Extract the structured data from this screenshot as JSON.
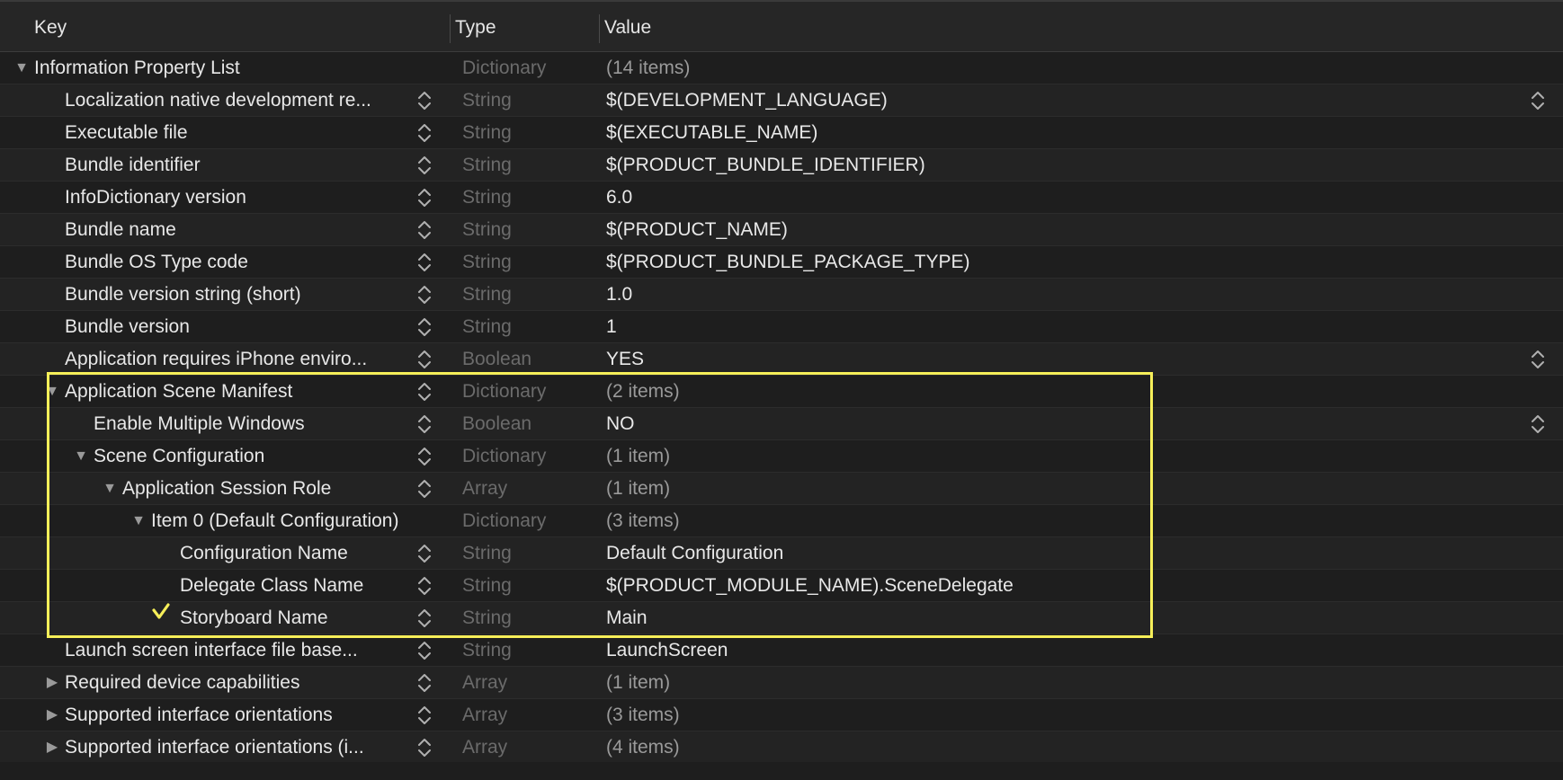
{
  "header": {
    "key": "Key",
    "type": "Type",
    "value": "Value"
  },
  "colors": {
    "highlight": "#f6ef59",
    "background": "#1e1e1e"
  },
  "rows": [
    {
      "key": "Information Property List",
      "type": "Dictionary",
      "value": "(14 items)",
      "indent": 0,
      "disclosure": "open",
      "stepper": false,
      "value_stepper": false
    },
    {
      "key": "Localization native development re...",
      "type": "String",
      "value": "$(DEVELOPMENT_LANGUAGE)",
      "indent": 1,
      "disclosure": "none",
      "stepper": true,
      "value_stepper": true
    },
    {
      "key": "Executable file",
      "type": "String",
      "value": "$(EXECUTABLE_NAME)",
      "indent": 1,
      "disclosure": "none",
      "stepper": true,
      "value_stepper": false
    },
    {
      "key": "Bundle identifier",
      "type": "String",
      "value": "$(PRODUCT_BUNDLE_IDENTIFIER)",
      "indent": 1,
      "disclosure": "none",
      "stepper": true,
      "value_stepper": false
    },
    {
      "key": "InfoDictionary version",
      "type": "String",
      "value": "6.0",
      "indent": 1,
      "disclosure": "none",
      "stepper": true,
      "value_stepper": false
    },
    {
      "key": "Bundle name",
      "type": "String",
      "value": "$(PRODUCT_NAME)",
      "indent": 1,
      "disclosure": "none",
      "stepper": true,
      "value_stepper": false
    },
    {
      "key": "Bundle OS Type code",
      "type": "String",
      "value": "$(PRODUCT_BUNDLE_PACKAGE_TYPE)",
      "indent": 1,
      "disclosure": "none",
      "stepper": true,
      "value_stepper": false
    },
    {
      "key": "Bundle version string (short)",
      "type": "String",
      "value": "1.0",
      "indent": 1,
      "disclosure": "none",
      "stepper": true,
      "value_stepper": false
    },
    {
      "key": "Bundle version",
      "type": "String",
      "value": "1",
      "indent": 1,
      "disclosure": "none",
      "stepper": true,
      "value_stepper": false
    },
    {
      "key": "Application requires iPhone enviro...",
      "type": "Boolean",
      "value": "YES",
      "indent": 1,
      "disclosure": "none",
      "stepper": true,
      "value_stepper": true
    },
    {
      "key": "Application Scene Manifest",
      "type": "Dictionary",
      "value": "(2 items)",
      "indent": 1,
      "disclosure": "open",
      "stepper": true,
      "value_stepper": false
    },
    {
      "key": "Enable Multiple Windows",
      "type": "Boolean",
      "value": "NO",
      "indent": 2,
      "disclosure": "none",
      "stepper": true,
      "value_stepper": true
    },
    {
      "key": "Scene Configuration",
      "type": "Dictionary",
      "value": "(1 item)",
      "indent": 2,
      "disclosure": "open",
      "stepper": true,
      "value_stepper": false
    },
    {
      "key": "Application Session Role",
      "type": "Array",
      "value": "(1 item)",
      "indent": 3,
      "disclosure": "open",
      "stepper": true,
      "value_stepper": false
    },
    {
      "key": "Item 0 (Default Configuration)",
      "type": "Dictionary",
      "value": "(3 items)",
      "indent": 4,
      "disclosure": "open",
      "stepper": false,
      "value_stepper": false
    },
    {
      "key": "Configuration Name",
      "type": "String",
      "value": "Default Configuration",
      "indent": 5,
      "disclosure": "none",
      "stepper": true,
      "value_stepper": false
    },
    {
      "key": "Delegate Class Name",
      "type": "String",
      "value": "$(PRODUCT_MODULE_NAME).SceneDelegate",
      "indent": 5,
      "disclosure": "none",
      "stepper": true,
      "value_stepper": false
    },
    {
      "key": "Storyboard Name",
      "type": "String",
      "value": "Main",
      "indent": 5,
      "disclosure": "none",
      "stepper": true,
      "value_stepper": false
    },
    {
      "key": "Launch screen interface file base...",
      "type": "String",
      "value": "LaunchScreen",
      "indent": 1,
      "disclosure": "none",
      "stepper": true,
      "value_stepper": false
    },
    {
      "key": "Required device capabilities",
      "type": "Array",
      "value": "(1 item)",
      "indent": 1,
      "disclosure": "closed",
      "stepper": true,
      "value_stepper": false
    },
    {
      "key": "Supported interface orientations",
      "type": "Array",
      "value": "(3 items)",
      "indent": 1,
      "disclosure": "closed",
      "stepper": true,
      "value_stepper": false
    },
    {
      "key": "Supported interface orientations (i...",
      "type": "Array",
      "value": "(4 items)",
      "indent": 1,
      "disclosure": "closed",
      "stepper": true,
      "value_stepper": false
    }
  ]
}
